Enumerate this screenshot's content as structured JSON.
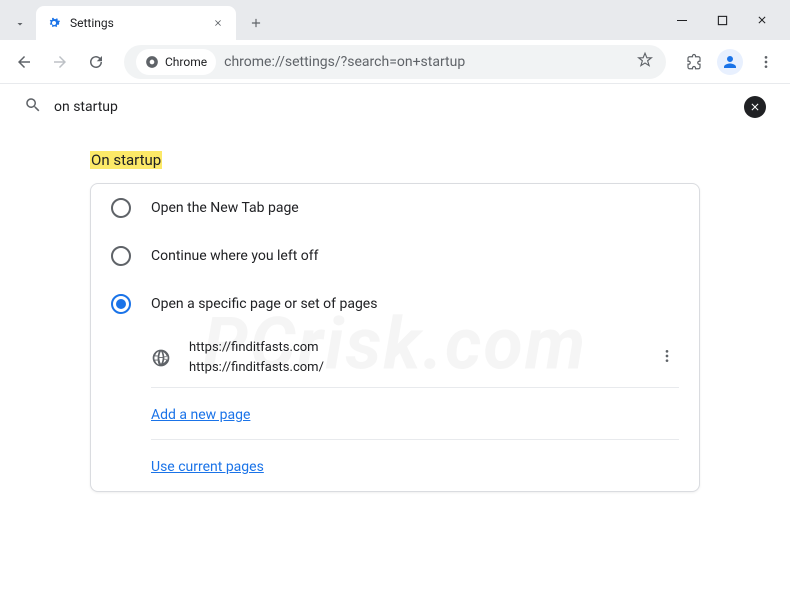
{
  "titlebar": {
    "tab_title": "Settings"
  },
  "toolbar": {
    "chrome_chip": "Chrome",
    "url": "chrome://settings/?search=on+startup"
  },
  "search": {
    "query": "on startup"
  },
  "section": {
    "title": "On startup"
  },
  "radios": {
    "option1": "Open the New Tab page",
    "option2": "Continue where you left off",
    "option3": "Open a specific page or set of pages"
  },
  "startup_page": {
    "url1": "https://finditfasts.com",
    "url2": "https://finditfasts.com/"
  },
  "links": {
    "add_page": "Add a new page",
    "use_current": "Use current pages"
  },
  "watermark": "PCrisk.com"
}
